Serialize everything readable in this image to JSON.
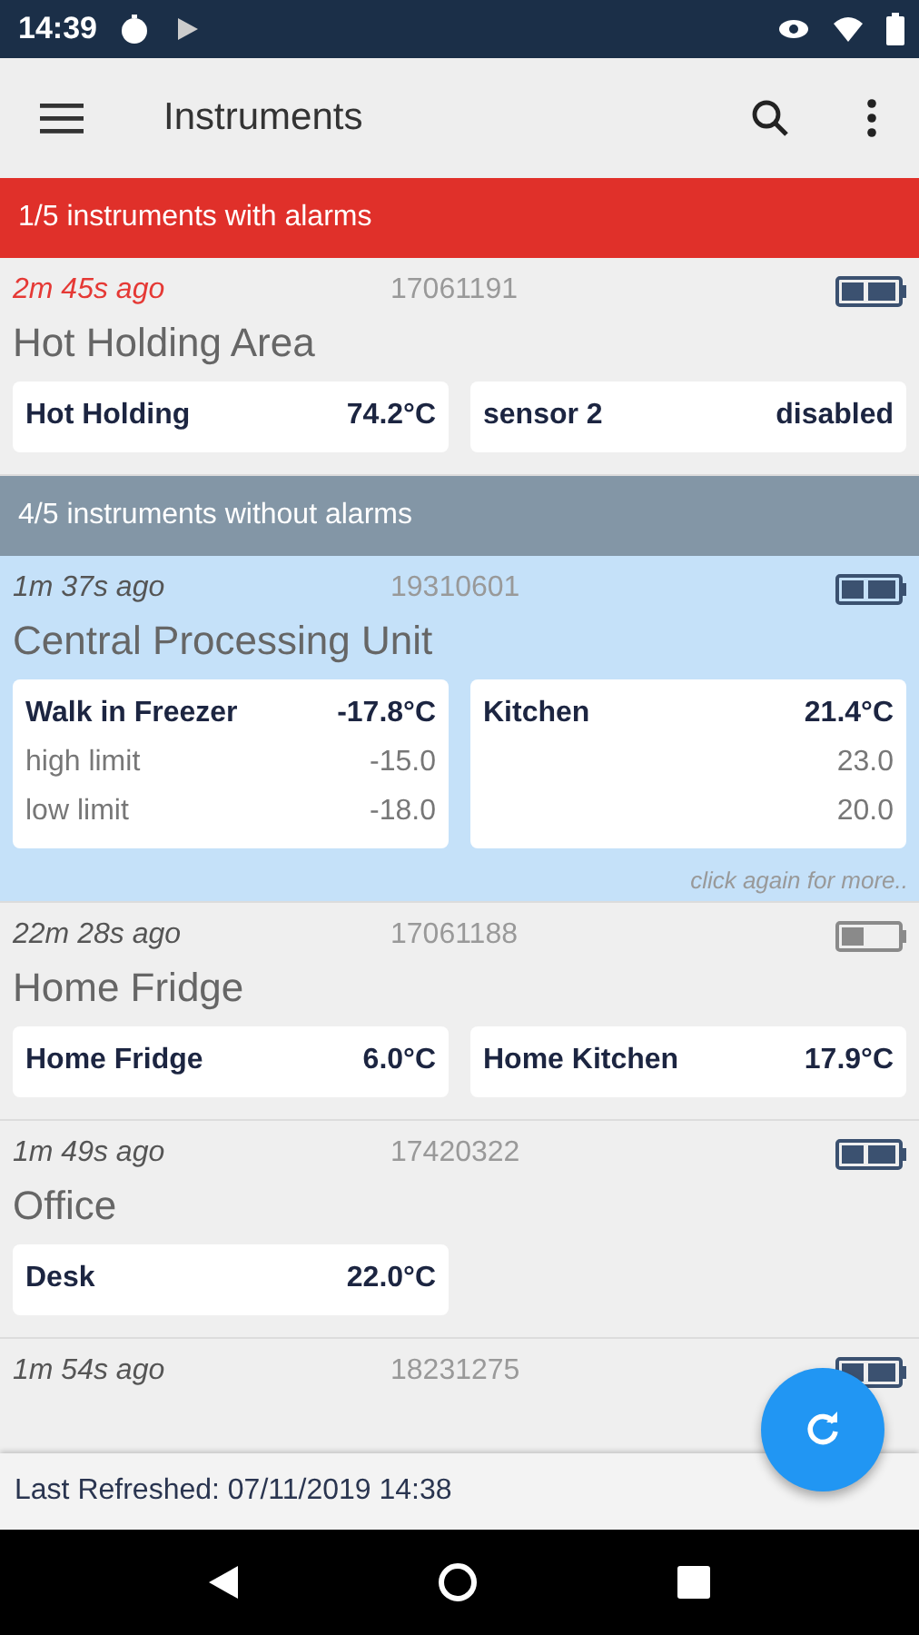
{
  "status_bar": {
    "time": "14:39"
  },
  "app_bar": {
    "title": "Instruments"
  },
  "sections": [
    {
      "kind": "alarm",
      "header": "1/5 instruments with alarms",
      "instruments": [
        {
          "ago": "2m 45s ago",
          "serial": "17061191",
          "name": "Hot Holding Area",
          "alarm": true,
          "selected": false,
          "battery_low": false,
          "sensors": [
            {
              "name": "Hot Holding",
              "value": "74.2°C"
            },
            {
              "name": "sensor 2",
              "value": "disabled"
            }
          ]
        }
      ]
    },
    {
      "kind": "normal",
      "header": "4/5 instruments without alarms",
      "instruments": [
        {
          "ago": "1m 37s ago",
          "serial": "19310601",
          "name": "Central Processing Unit",
          "alarm": false,
          "selected": true,
          "battery_low": false,
          "hint": "click again for more..",
          "sensors": [
            {
              "name": "Walk in Freezer",
              "value": "-17.8°C",
              "limits": [
                {
                  "label": "high limit",
                  "value": "-15.0"
                },
                {
                  "label": "low limit",
                  "value": "-18.0"
                }
              ]
            },
            {
              "name": "Kitchen",
              "value": "21.4°C",
              "limits": [
                {
                  "value": "23.0"
                },
                {
                  "value": "20.0"
                }
              ]
            }
          ]
        },
        {
          "ago": "22m 28s ago",
          "serial": "17061188",
          "name": "Home Fridge",
          "alarm": false,
          "selected": false,
          "battery_low": true,
          "sensors": [
            {
              "name": "Home Fridge",
              "value": "6.0°C"
            },
            {
              "name": "Home Kitchen",
              "value": "17.9°C"
            }
          ]
        },
        {
          "ago": "1m 49s ago",
          "serial": "17420322",
          "name": "Office",
          "alarm": false,
          "selected": false,
          "battery_low": false,
          "sensors": [
            {
              "name": "Desk",
              "value": "22.0°C"
            }
          ]
        },
        {
          "ago": "1m 54s ago",
          "serial": "18231275",
          "alarm": false,
          "selected": false,
          "battery_low": false
        }
      ]
    }
  ],
  "footer": {
    "last_refreshed": "Last Refreshed: 07/11/2019 14:38"
  }
}
